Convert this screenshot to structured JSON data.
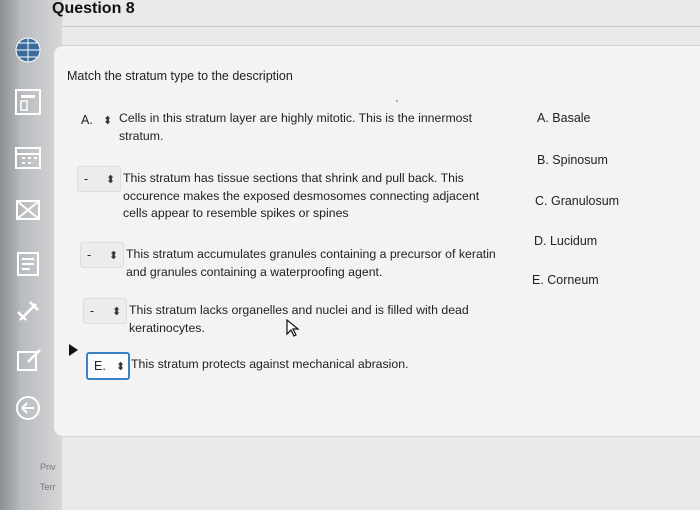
{
  "question": {
    "title": "Question 8",
    "instruction": "Match the stratum type to the description"
  },
  "items": [
    {
      "selected": "A.",
      "description_line1": "Cells in this stratum layer are highly mitotic. This is the innermost",
      "description_line2": "stratum.",
      "description_line3": ""
    },
    {
      "selected": "-",
      "description_line1": "This stratum has tissue sections that shrink and pull back. This",
      "description_line2": "occurence makes the exposed desmosomes connecting adjacent",
      "description_line3": "cells appear to resemble spikes or spines"
    },
    {
      "selected": "-",
      "description_line1": "This stratum accumulates granules containing a precursor of keratin",
      "description_line2": "and granules containing a waterproofing agent.",
      "description_line3": ""
    },
    {
      "selected": "-",
      "description_line1": "This stratum lacks organelles and nuclei and is filled with dead",
      "description_line2": "keratinocytes.",
      "description_line3": ""
    },
    {
      "selected": "E.",
      "description_line1": "This stratum protects against mechanical abrasion.",
      "description_line2": "",
      "description_line3": ""
    }
  ],
  "answers": [
    "A. Basale",
    "B. Spinosum",
    "C. Granulosum",
    "D. Lucidum",
    "E. Corneum"
  ],
  "sidebar": {
    "text1": "Priv",
    "text2": "Terr",
    "icons": [
      "globe-icon",
      "gradebook-icon",
      "calendar-icon",
      "inbox-icon",
      "history-icon",
      "satellite-icon",
      "commons-icon",
      "back-arrow-icon"
    ]
  },
  "colors": {
    "focus": "#3b7fc4",
    "card": "#f3f3f3"
  }
}
